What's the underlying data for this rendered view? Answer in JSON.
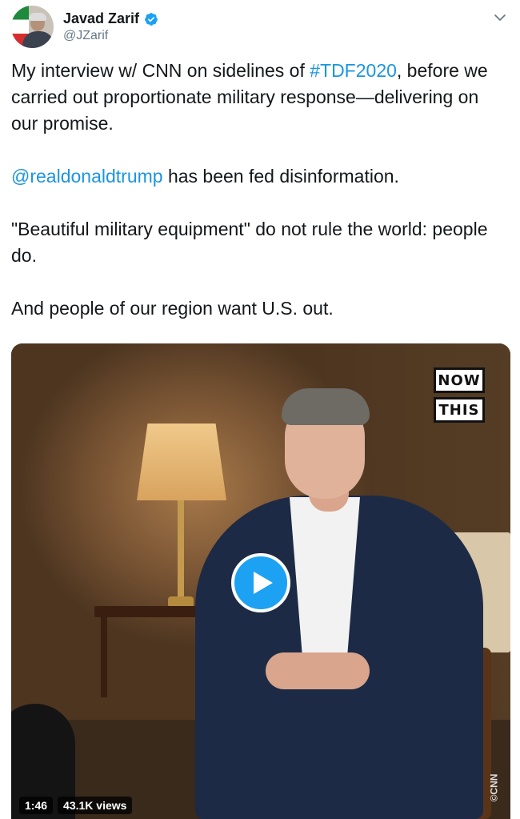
{
  "author": {
    "display_name": "Javad Zarif",
    "handle": "@JZarif",
    "verified": true,
    "avatar_icon": "profile-avatar"
  },
  "tweet": {
    "line1_before": "My interview w/ CNN on sidelines of ",
    "hashtag": "#TDF2020",
    "line1_after": ", before we carried out proportionate military response—delivering on our promise.",
    "mention": "@realdonaldtrump",
    "mention_after": " has been fed disinformation.",
    "paragraph3": "\"Beautiful military equipment\" do not rule the world: people do.",
    "paragraph4": "And people of our region want U.S. out."
  },
  "media": {
    "logo_line1": "NOW",
    "logo_line2": "THIS",
    "watermark": "©CNN",
    "duration": "1:46",
    "views": "43.1K views",
    "play_icon": "play-icon"
  },
  "colors": {
    "link": "#1b95e0",
    "play_button": "#1da1f2",
    "verified": "#1da1f2"
  }
}
